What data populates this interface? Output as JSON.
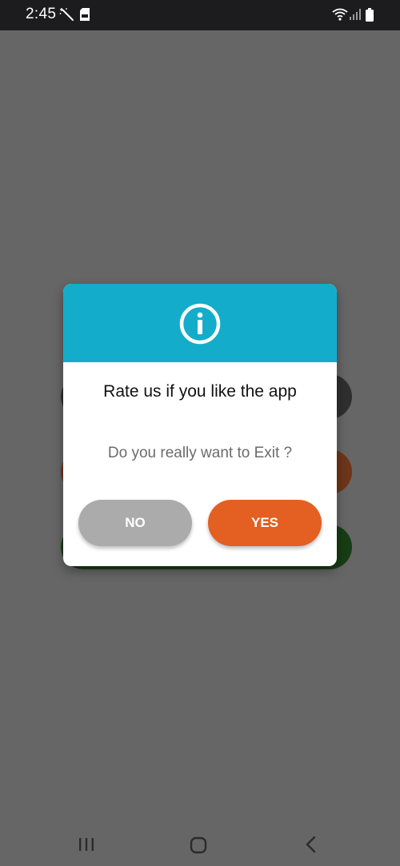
{
  "status_bar": {
    "time": "2:45",
    "icons": [
      "magic-wand-icon",
      "sd-card-icon",
      "wifi-icon",
      "signal-icon",
      "battery-icon"
    ]
  },
  "dialog": {
    "header_icon": "info-icon",
    "header_color": "#13adcb",
    "title": "Rate us if you like the app",
    "message": "Do you really want to Exit ?",
    "no_label": "NO",
    "yes_label": "YES",
    "no_color": "#ababab",
    "yes_color": "#e35f22"
  },
  "nav_bar": {
    "icons": [
      "recents-icon",
      "home-icon",
      "back-icon"
    ]
  }
}
